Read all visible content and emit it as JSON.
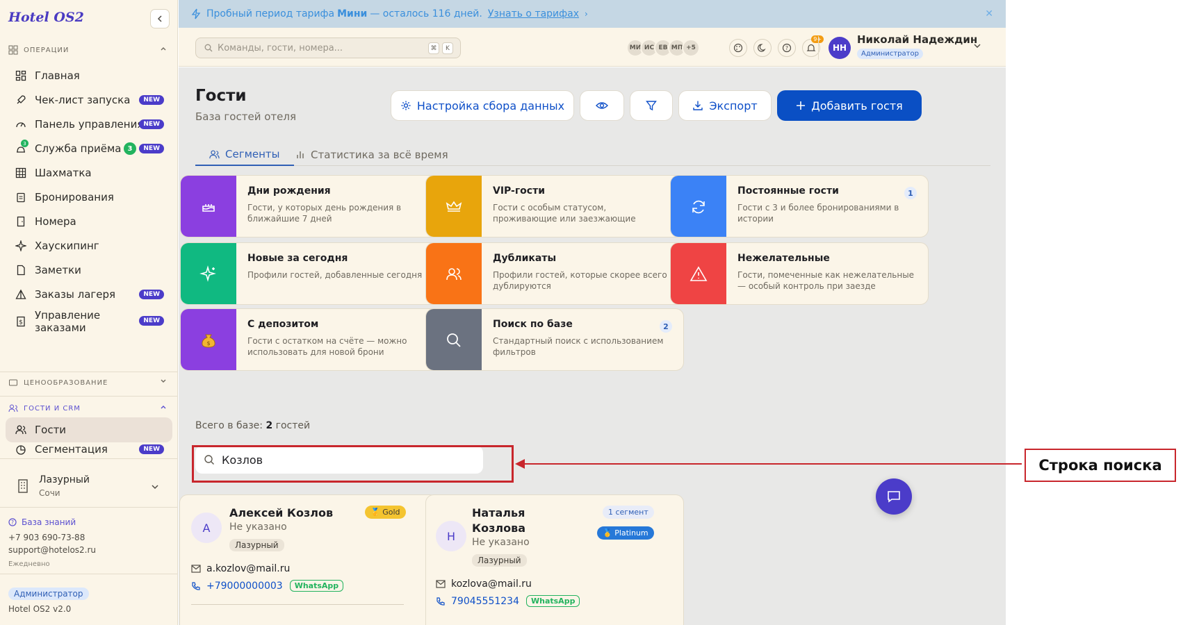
{
  "app": {
    "brand": "Hotel OS2"
  },
  "sidebar": {
    "sections": {
      "operations": "ОПЕРАЦИИ",
      "pricing": "ЦЕНООБРАЗОВАНИЕ",
      "crm": "ГОСТИ И CRM"
    },
    "items": [
      {
        "label": "Главная",
        "icon": "dashboard-icon"
      },
      {
        "label": "Чек-лист запуска",
        "icon": "rocket-icon",
        "badge": "NEW"
      },
      {
        "label": "Панель управления",
        "icon": "gauge-icon",
        "badge": "NEW"
      },
      {
        "label": "Служба приёма",
        "icon": "bell-icon",
        "badge": "NEW",
        "count": "3",
        "mini_count": "3"
      },
      {
        "label": "Шахматка",
        "icon": "grid-icon"
      },
      {
        "label": "Бронирования",
        "icon": "clipboard-icon"
      },
      {
        "label": "Номера",
        "icon": "door-icon"
      },
      {
        "label": "Хаускипинг",
        "icon": "sparkle-icon"
      },
      {
        "label": "Заметки",
        "icon": "note-icon"
      },
      {
        "label": "Заказы лагеря",
        "icon": "tent-icon",
        "badge": "NEW"
      },
      {
        "label": "Управление",
        "label2": "заказами",
        "icon": "receipt-icon",
        "badge": "NEW"
      }
    ],
    "crm_items": [
      {
        "label": "Гости",
        "icon": "users-icon",
        "active": true
      },
      {
        "label": "Сегментация",
        "icon": "pie-icon",
        "badge": "NEW"
      }
    ],
    "hotel": {
      "name": "Лазурный",
      "city": "Сочи"
    },
    "help": {
      "link": "База знаний",
      "phone": "+7 903 690-73-88",
      "email": "support@hotelos2.ru",
      "schedule": "Ежедневно"
    },
    "role": "Администратор",
    "version": "Hotel OS2 v2.0"
  },
  "banner": {
    "prefix": "Пробный период тарифа",
    "plan": "Мини",
    "suffix": "— осталось 116 дней.",
    "link": "Узнать о тарифах"
  },
  "topbar": {
    "search_placeholder": "Команды, гости, номера...",
    "kbd1": "⌘",
    "kbd2": "K",
    "avatars": [
      "МИ",
      "ИС",
      "ЕВ",
      "МП",
      "+5"
    ],
    "notif_badge": "9+",
    "user": {
      "initials": "НН",
      "name": "Николай Надеждин",
      "role": "Администратор"
    }
  },
  "page": {
    "title": "Гости",
    "subtitle": "База гостей отеля",
    "buttons": {
      "settings": "Настройка сбора данных",
      "export": "Экспорт",
      "add": "Добавить гостя"
    },
    "tabs": [
      "Сегменты",
      "Статистика за всё время"
    ],
    "segments": [
      {
        "title": "Дни рождения",
        "desc": "Гости, у которых день рождения в ближайшие 7 дней",
        "color": "#8b3fe0",
        "icon": "cake-icon"
      },
      {
        "title": "VIP-гости",
        "desc": "Гости с особым статусом, проживающие или заезжающие",
        "color": "#e8a50c",
        "icon": "crown-icon"
      },
      {
        "title": "Постоянные гости",
        "desc": "Гости с 3 и более бронированиями в истории",
        "color": "#3b82f6",
        "icon": "refresh-icon",
        "count": "1"
      },
      {
        "title": "Новые за сегодня",
        "desc": "Профили гостей, добавленные сегодня",
        "color": "#10b981",
        "icon": "sparkles-icon"
      },
      {
        "title": "Дубликаты",
        "desc": "Профили гостей, которые скорее всего дублируются",
        "color": "#f97316",
        "icon": "users-icon"
      },
      {
        "title": "Нежелательные",
        "desc": "Гости, помеченные как нежелательные — особый контроль при заезде",
        "color": "#ef4444",
        "icon": "warning-icon"
      },
      {
        "title": "С депозитом",
        "desc": "Гости с остатком на счёте — можно использовать для новой брони",
        "color": "#8b3fe0",
        "icon": "money-bag-icon"
      },
      {
        "title": "Поиск по базе",
        "desc": "Стандартный поиск с использованием фильтров",
        "color": "#6b7280",
        "icon": "search-icon",
        "count": "2"
      }
    ],
    "total_prefix": "Всего в базе:",
    "total_count": "2",
    "total_suffix": "гостей",
    "guest_search_value": "Козлов",
    "guests": [
      {
        "initial": "А",
        "name": "Алексей Козлов",
        "name2": "",
        "sub": "Не указано",
        "hotel": "Лазурный",
        "tier": "🥇 Gold",
        "email": "a.kozlov@mail.ru",
        "phone": "+79000000003",
        "messenger": "WhatsApp"
      },
      {
        "initial": "Н",
        "name": "Наталья",
        "name2": "Козлова",
        "sub": "Не указано",
        "hotel": "Лазурный",
        "tier": "🥇 Platinum",
        "segment": "1 сегмент",
        "email": "kozlova@mail.ru",
        "phone": "79045551234",
        "messenger": "WhatsApp"
      }
    ]
  },
  "annotation": {
    "label": "Строка поиска"
  }
}
